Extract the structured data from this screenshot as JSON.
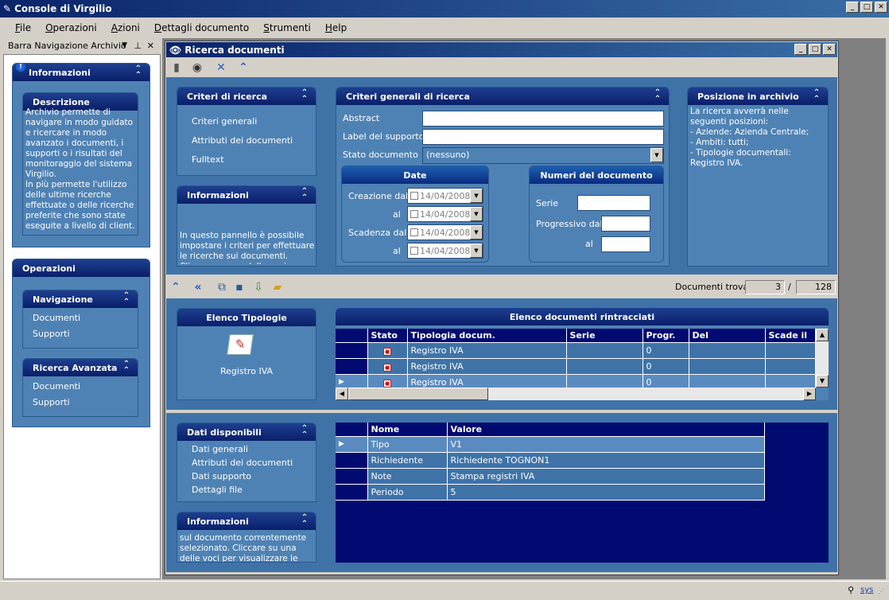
{
  "app": {
    "title": "Console di Virgilio"
  },
  "menu": [
    "File",
    "Operazioni",
    "Azioni",
    "Dettagli documento",
    "Strumenti",
    "Help"
  ],
  "nav": {
    "title": "Barra Navigazione Archivio",
    "info_header": "Informazioni",
    "descr_header": "Descrizione",
    "descr_text": "Archivio permette di navigare in modo guidato e ricercare in modo avanzato i documenti, i supporti o i risultati del monitoraggio del sistema Virgilio.\nIn più permette l'utilizzo delle ultime ricerche effettuate o delle ricerche preferite che sono state eseguite a livello di client.",
    "ops_header": "Operazioni",
    "navigazione_header": "Navigazione",
    "navigazione_items": [
      "Documenti",
      "Supporti"
    ],
    "ricerca_header": "Ricerca Avanzata",
    "ricerca_items": [
      "Documenti",
      "Supporti"
    ]
  },
  "search_window": {
    "title": "Ricerca documenti"
  },
  "criteri": {
    "header": "Criteri di ricerca",
    "items": [
      "Criteri generali",
      "Attributi dei documenti",
      "Fulltext"
    ]
  },
  "info1": {
    "header": "Informazioni",
    "text": "In questo pannello è possibile impostare i criteri per effettuare le ricerche sui documenti. Cliccare su una delle voci per visualizzare"
  },
  "generali": {
    "header": "Criteri generali di ricerca",
    "abstract_label": "Abstract",
    "abstract_value": "",
    "label_supporto": "Label del supporto",
    "label_supporto_value": "",
    "stato_label": "Stato documento",
    "stato_value": "(nessuno)",
    "date": {
      "header": "Date",
      "creazione_dal": "Creazione dal",
      "al": "al",
      "scadenza_dal": "Scadenza dal",
      "values": [
        "14/04/2008",
        "14/04/2008",
        "14/04/2008",
        "14/04/2008"
      ]
    },
    "numeri": {
      "header": "Numeri del documento",
      "serie": "Serie",
      "progressivo_dal": "Progressivo dal",
      "al": "al"
    }
  },
  "posizione": {
    "header": "Posizione in archivio",
    "text": "La ricerca avverrà nelle seguenti posizioni:\n- Aziende: Azienda Centrale;\n- Ambiti: tutti;\n- Tipologie documentali: Registro IVA."
  },
  "results_bar": {
    "label": "Documenti trovati",
    "found": "3",
    "sep": "/",
    "total": "128"
  },
  "tipologie": {
    "header": "Elenco Tipologie",
    "item": "Registro IVA"
  },
  "elenco": {
    "header": "Elenco documenti rintracciati",
    "columns": [
      "Stato",
      "Tipologia docum.",
      "Serie",
      "Progr.",
      "Del",
      "Scade il"
    ],
    "rows": [
      {
        "tipologia": "Registro IVA",
        "serie": "",
        "progr": "0",
        "del": "",
        "scade": ""
      },
      {
        "tipologia": "Registro IVA",
        "serie": "",
        "progr": "0",
        "del": "",
        "scade": ""
      },
      {
        "tipologia": "Registro IVA",
        "serie": "",
        "progr": "0",
        "del": "",
        "scade": ""
      }
    ]
  },
  "dati": {
    "header": "Dati disponibili",
    "items": [
      "Dati generali",
      "Attributi dei documenti",
      "Dati supporto",
      "Dettagli file"
    ]
  },
  "info2": {
    "header": "Informazioni",
    "text": "sul documento correntemente selezionato. Cliccare su una delle voci per visualizzare le informazioni"
  },
  "props": {
    "columns": [
      "Nome",
      "Valore"
    ],
    "rows": [
      {
        "nome": "Tipo",
        "valore": "V1"
      },
      {
        "nome": "Richiedente",
        "valore": "Richiedente  TOGNON1"
      },
      {
        "nome": "Note",
        "valore": "Stampa registri IVA"
      },
      {
        "nome": "Periodo",
        "valore": "5"
      }
    ]
  },
  "status": {
    "user": "sys"
  },
  "colors": {
    "titlebar": "#0a246a",
    "panel": "#4f82b4",
    "background": "#3f73a8",
    "grid_header": "#000a70"
  }
}
